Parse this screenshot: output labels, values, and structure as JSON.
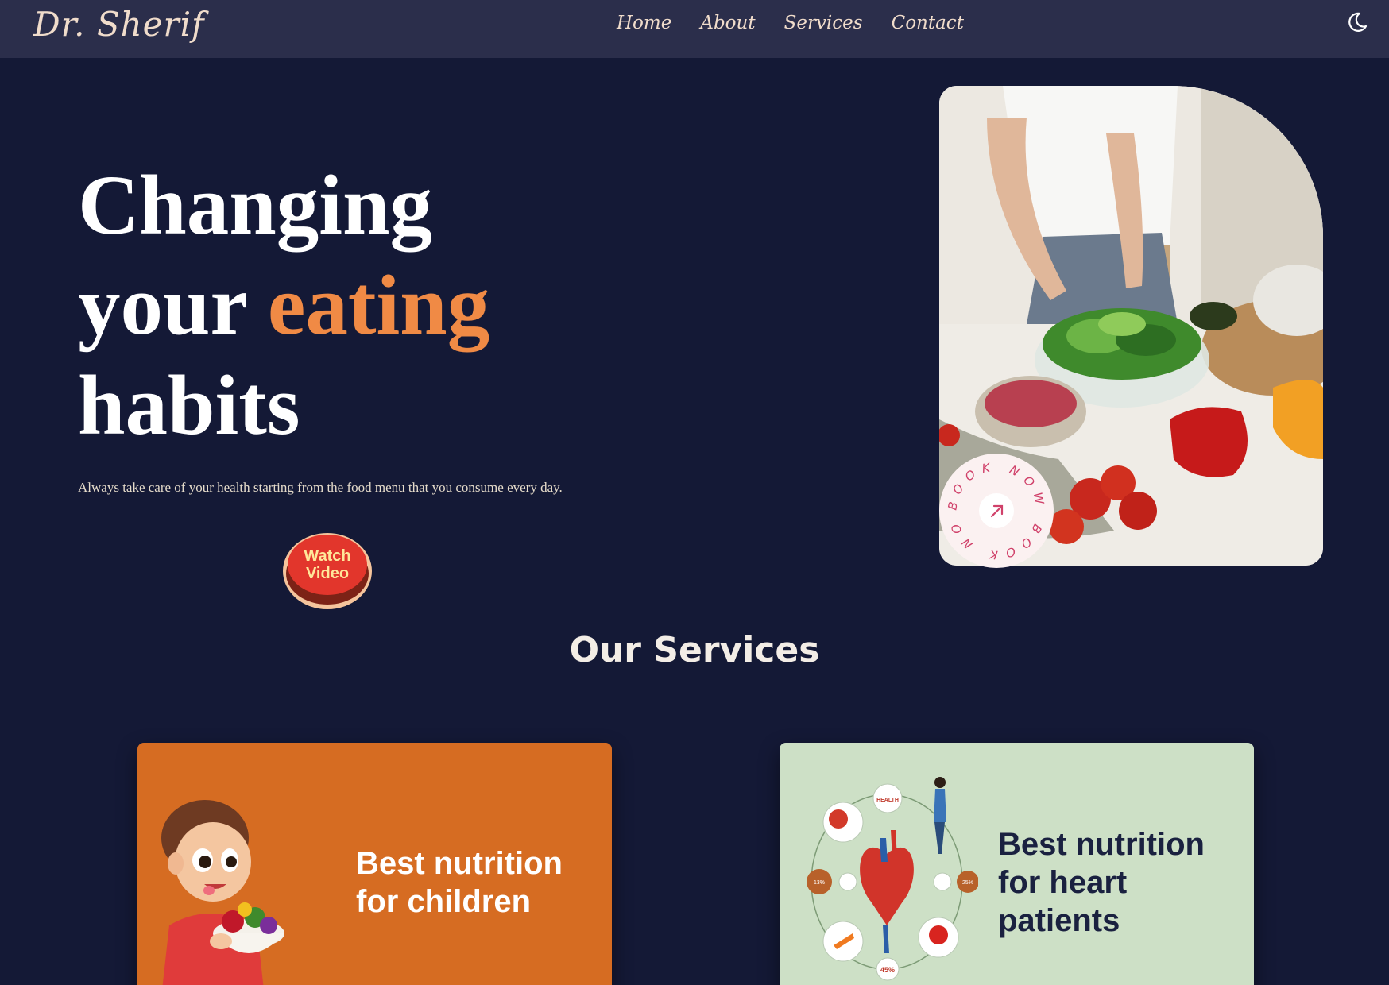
{
  "nav": {
    "logo": "Dr. Sherif",
    "links": [
      "Home",
      "About",
      "Services",
      "Contact"
    ],
    "theme_icon": "moon-icon"
  },
  "hero": {
    "title_line1": "Changing",
    "title_line2_plain": "your",
    "title_line2_accent": "eating",
    "title_line3": "habits",
    "subtitle": "Always take care of your health starting from the food menu that you consume every day.",
    "watch_line1": "Watch",
    "watch_line2": "Video",
    "book_badge_text": "BOOK NOW BOOK NOW",
    "book_icon": "arrow-up-right-icon"
  },
  "services": {
    "heading": "Our Services",
    "cards": [
      {
        "title": "Best nutrition for children",
        "image": "child-with-fruit-bowl-illustration"
      },
      {
        "title": "Best nutrition for heart patients",
        "image": "heart-health-infographic",
        "infographic_labels": [
          "HEALTH",
          "13%",
          "25%",
          "45%"
        ]
      }
    ]
  },
  "colors": {
    "background": "#141936",
    "navbar": "#2b2e4b",
    "accent": "#f08a45",
    "card_orange": "#d66c22",
    "card_green": "#cde0c6"
  }
}
